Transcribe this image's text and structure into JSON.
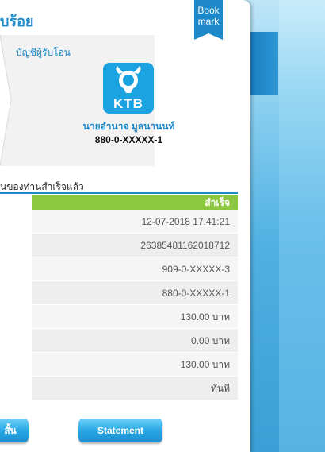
{
  "title": "บร้อย",
  "bookmark": {
    "line1": "Book",
    "line2": "mark"
  },
  "recipient": {
    "label": "บัญชีผู้รับโอน",
    "bank_logo_text": "KTB",
    "name": "นายอำนาจ มูลนานนท์",
    "account": "880-0-XXXXX-1"
  },
  "result": {
    "message": "นของท่านสำเร็จแล้ว",
    "header": "สำเร็จ",
    "rows": [
      "12-07-2018 17:41:21",
      "26385481162018712",
      "909-0-XXXXX-3",
      "880-0-XXXXX-1",
      "130.00 บาท",
      "0.00 บาท",
      "130.00 บาท",
      "ทันที"
    ]
  },
  "buttons": {
    "left": "สั้น",
    "statement": "Statement"
  },
  "colors": {
    "accent": "#1d89c9",
    "success": "#8dc63f",
    "logo": "#1aa3e0"
  }
}
